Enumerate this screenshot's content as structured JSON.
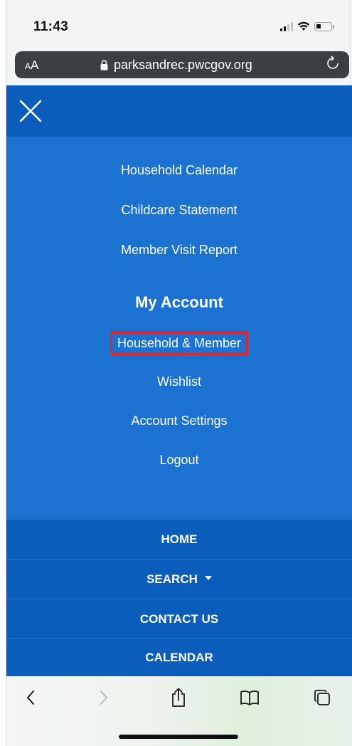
{
  "status_bar": {
    "time": "11:43"
  },
  "browser": {
    "aa_label": "AA",
    "url": "parksandrec.pwcgov.org"
  },
  "menu": {
    "links_top": [
      "Household Calendar",
      "Childcare Statement",
      "Member Visit Report"
    ],
    "section_title": "My Account",
    "highlighted_item": "Household & Member",
    "links_bottom": [
      "Wishlist",
      "Account Settings",
      "Logout"
    ]
  },
  "nav": {
    "home": "HOME",
    "search": "SEARCH",
    "contact": "CONTACT US",
    "calendar": "CALENDAR"
  },
  "colors": {
    "topbar": "#0b5dbb",
    "menu_bg": "#1b72d1",
    "highlight_border": "#e0252b"
  },
  "toolbar_icons": [
    "back-icon",
    "forward-icon",
    "share-icon",
    "bookmarks-icon",
    "tabs-icon"
  ]
}
